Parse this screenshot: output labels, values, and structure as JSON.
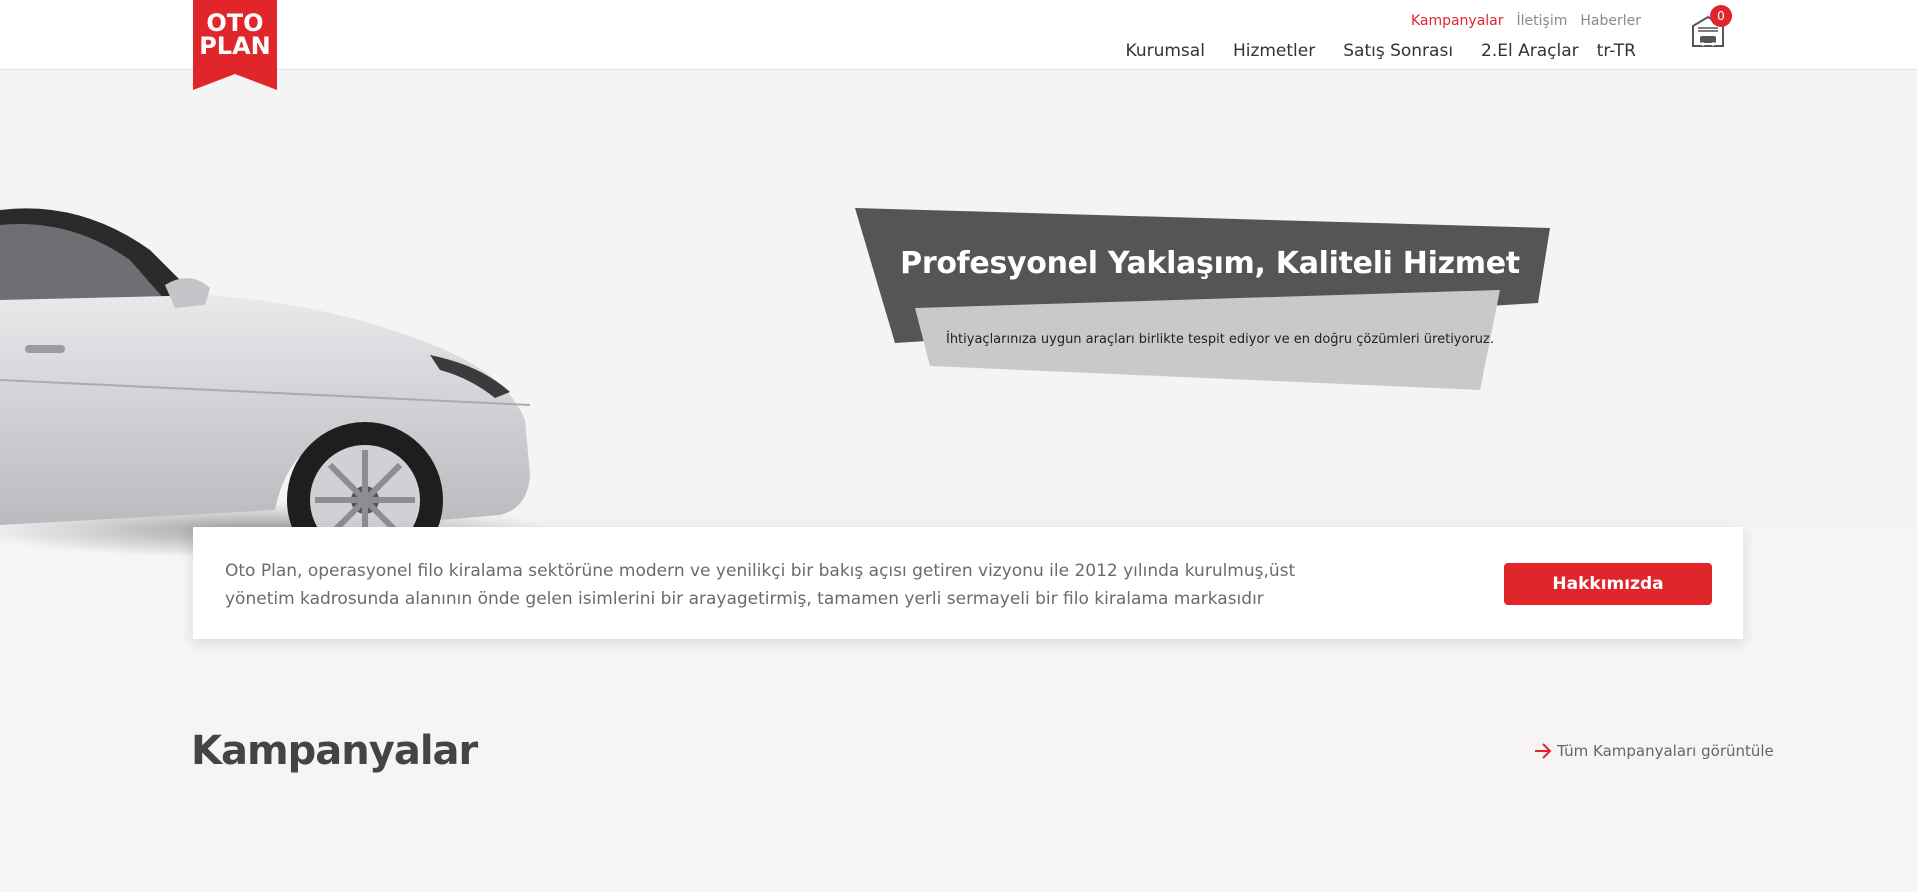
{
  "brand": {
    "logo_line1": "OTO",
    "logo_line2": "PLAN",
    "accent_color": "#e0262b"
  },
  "top_links": [
    {
      "label": "Kampanyalar",
      "active": true
    },
    {
      "label": "İletişim",
      "active": false
    },
    {
      "label": "Haberler",
      "active": false
    }
  ],
  "main_nav": [
    {
      "label": "Kurumsal"
    },
    {
      "label": "Hizmetler"
    },
    {
      "label": "Satış Sonrası"
    },
    {
      "label": "2.El Araçlar"
    },
    {
      "label": "tr-TR"
    }
  ],
  "garage": {
    "icon": "garage-icon",
    "count": "0"
  },
  "hero": {
    "title": "Profesyonel Yaklaşım, Kaliteli Hizmet",
    "subtitle": "İhtiyaçlarınıza uygun araçları birlikte tespit ediyor ve en doğru çözümleri üretiyoruz."
  },
  "about": {
    "text": "Oto Plan, operasyonel filo kiralama sektörüne modern ve yenilikçi bir bakış açısı getiren vizyonu ile 2012 yılında kurulmuş,üst yönetim kadrosunda alanının önde gelen isimlerini bir arayagetirmiş, tamamen yerli sermayeli bir filo kiralama markasıdır",
    "button_label": "Hakkımızda"
  },
  "campaigns": {
    "title": "Kampanyalar",
    "view_all_label": "Tüm Kampanyaları görüntüle",
    "view_all_icon": "arrow-right-icon"
  }
}
